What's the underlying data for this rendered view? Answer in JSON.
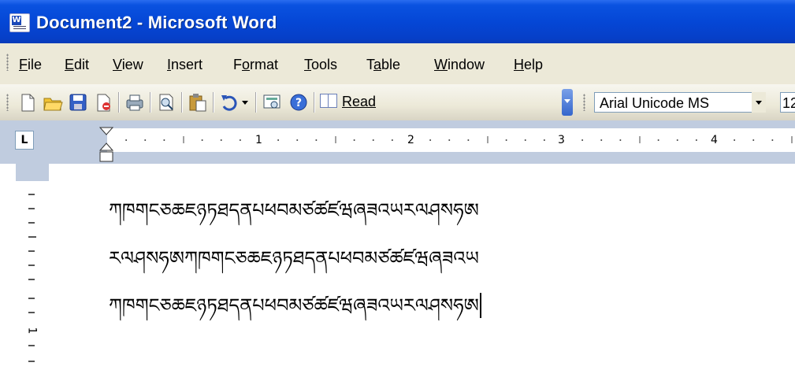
{
  "window": {
    "title": "Document2 - Microsoft Word"
  },
  "menu": [
    {
      "label": "File",
      "key": "F"
    },
    {
      "label": "Edit",
      "key": "E"
    },
    {
      "label": "View",
      "key": "V"
    },
    {
      "label": "Insert",
      "key": "I"
    },
    {
      "label": "Format",
      "key": "o"
    },
    {
      "label": "Tools",
      "key": "T"
    },
    {
      "label": "Table",
      "key": "a"
    },
    {
      "label": "Window",
      "key": "W"
    },
    {
      "label": "Help",
      "key": "H"
    }
  ],
  "toolbar": {
    "read_label": "Read",
    "font_name": "Arial Unicode MS",
    "font_size": "12",
    "icons": [
      "new-document-icon",
      "open-folder-icon",
      "save-icon",
      "permission-icon",
      "print-icon",
      "print-preview-icon",
      "paste-icon",
      "undo-icon",
      "undo-dropdown-icon",
      "research-icon",
      "help-icon",
      "read-icon"
    ]
  },
  "ruler": {
    "numbers": [
      "1",
      "2",
      "3",
      "4"
    ],
    "vertical_number": "1"
  },
  "colors": {
    "titlebar": "#0547d6",
    "chrome": "#ece9d8",
    "ruler": "#c0ccdf"
  },
  "document": {
    "lines": [
      "ཀཁགངཅཆཇཉཏཐདནཔཕབམཙཚཛཝཞཟའཡརལཤསཧཨ",
      "རལཤསཧཨཀཁགངཅཆཇཉཏཐདནཔཕབམཙཚཛཝཞཟའཡ",
      "ཀཁགངཅཆཇཉཏཐདནཔཕབམཙཚཛཝཞཟའཡརལཤསཧཨ"
    ]
  }
}
